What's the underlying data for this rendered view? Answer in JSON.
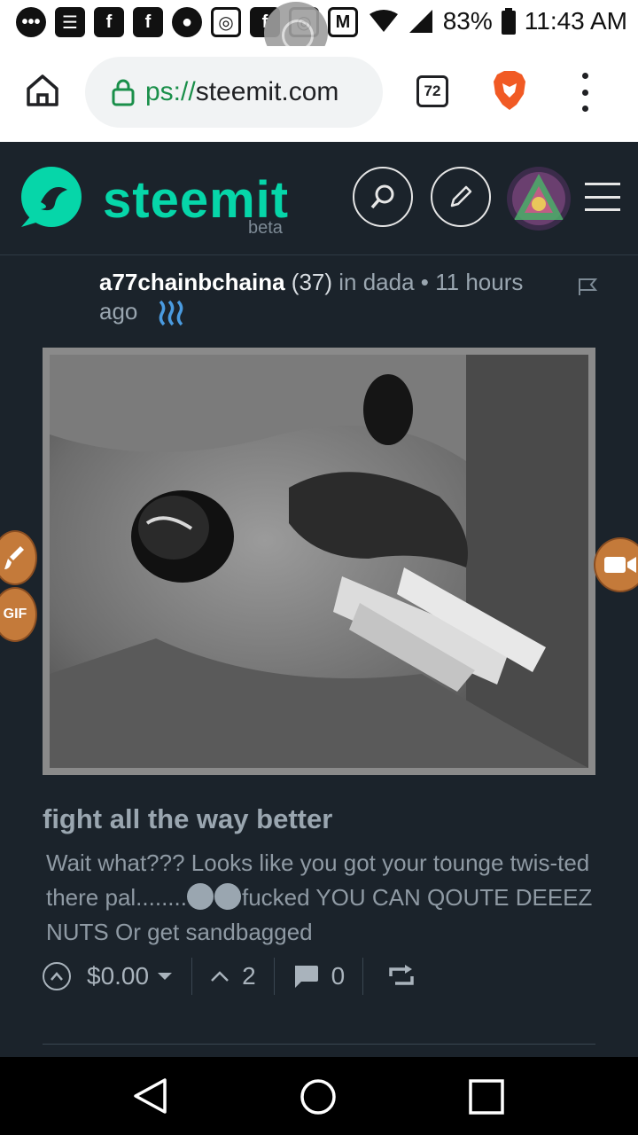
{
  "status_bar": {
    "battery": "83%",
    "time": "11:43 AM",
    "notification_icons": [
      "message-icon",
      "news-icon",
      "facebook-icon",
      "facebook-icon",
      "chat-icon",
      "instagram-icon",
      "facebook-icon",
      "instagram-icon",
      "gmail-icon"
    ]
  },
  "browser": {
    "url_scheme": "ps://",
    "url_host": "steemit.com",
    "tab_count": "72"
  },
  "header": {
    "brand": "steemit",
    "beta_label": "beta"
  },
  "post": {
    "author": "a77chainbchaina",
    "reputation": "(37)",
    "meta_text": " in dada • 11 hours ago",
    "title": "fight all the way better",
    "body_part1": "Wait what??? Looks like you got your tounge twis-ted there pal........",
    "body_part2": "fucked YOU CAN QOUTE DEEEZ NUTS Or get sandbagged",
    "payout": "$0.00",
    "votes": "2",
    "comments": "0"
  },
  "side_buttons": {
    "left_lower_label": "GIF"
  },
  "colors": {
    "brand_green": "#06d6a9",
    "background": "#1b232b",
    "fab_orange": "#c47a3a"
  }
}
